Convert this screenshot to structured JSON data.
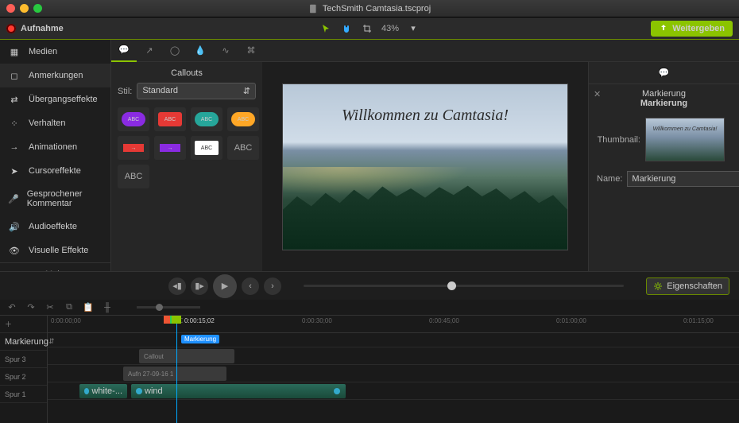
{
  "title": "TechSmith Camtasia.tscproj",
  "toolbar": {
    "record": "Aufnahme",
    "zoom": "43%",
    "share": "Weitergeben"
  },
  "sidebar": {
    "items": [
      {
        "label": "Medien"
      },
      {
        "label": "Anmerkungen"
      },
      {
        "label": "Übergangseffekte"
      },
      {
        "label": "Verhalten"
      },
      {
        "label": "Animationen"
      },
      {
        "label": "Cursoreffekte"
      },
      {
        "label": "Gesprochener Kommentar"
      },
      {
        "label": "Audioeffekte"
      },
      {
        "label": "Visuelle Effekte"
      }
    ],
    "more": "Mehr"
  },
  "callouts": {
    "title": "Callouts",
    "styleLabel": "Stil:",
    "styleValue": "Standard",
    "abc": "ABC"
  },
  "canvas": {
    "text": "Willkommen zu Camtasia!"
  },
  "props": {
    "tab1": "Markierung",
    "tab2": "Markierung",
    "thumbLabel": "Thumbnail:",
    "thumbText": "Willkommen zu Camtasia!",
    "nameLabel": "Name:",
    "nameValue": "Markierung",
    "eigenBtn": "Eigenschaften"
  },
  "timeline": {
    "playheadTime": "0:00:15;02",
    "markerRow": "Markierung",
    "markerChip": "Markierung",
    "tracks": [
      "Spur 3",
      "Spur 2",
      "Spur 1"
    ],
    "ticks": [
      "0:00:00;00",
      "0:00:15;00",
      "0:00:30;00",
      "0:00:45;00",
      "0:01:00;00",
      "0:01:15;00"
    ],
    "clip_callout": "Callout",
    "clip_aufn": "Aufn 27-09-16 1",
    "clip_white": "white-...",
    "clip_wind": "wind"
  }
}
